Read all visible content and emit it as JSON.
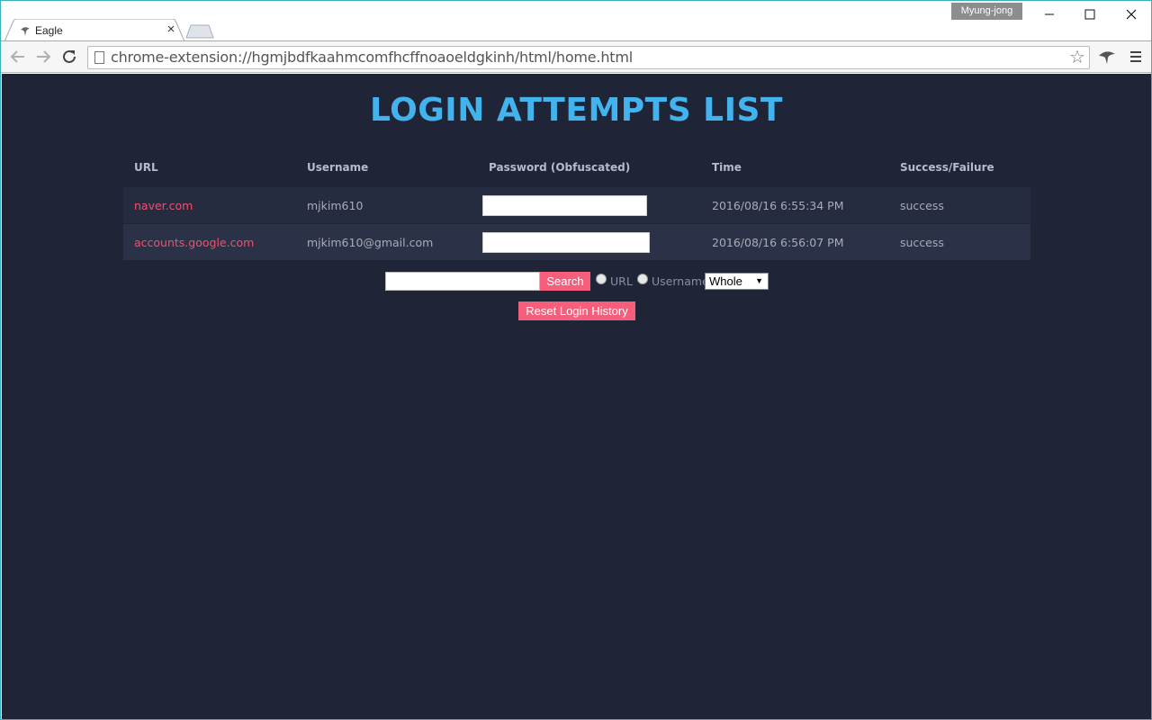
{
  "browser": {
    "tab_title": "Eagle",
    "tab_close": "×",
    "profile_name": "Myung-jong",
    "url": "chrome-extension://hgmjbdfkaahmcomfhcffnoaoeldgkinh/html/home.html",
    "back_glyph": "←",
    "forward_glyph": "→",
    "reload_glyph": "↻",
    "star_glyph": "☆",
    "menu_glyph": "≡",
    "minimize_glyph": "—",
    "maximize_glyph": "☐",
    "close_glyph": "✕"
  },
  "page": {
    "title": "LOGIN ATTEMPTS LIST",
    "columns": [
      "URL",
      "Username",
      "Password (Obfuscated)",
      "Time",
      "Success/Failure"
    ],
    "rows": [
      {
        "url": "naver.com",
        "username": "mjkim610",
        "password": "",
        "time": "2016/08/16 6:55:34 PM",
        "status": "success"
      },
      {
        "url": "accounts.google.com",
        "username": "mjkim610@gmail.com",
        "password": "",
        "time": "2016/08/16 6:56:07 PM",
        "status": "success"
      }
    ],
    "search": {
      "value": "",
      "button_label": "Search",
      "radio_url_label": "URL",
      "radio_username_label": "Username",
      "select_value": "Whole",
      "select_arrow": "▼"
    },
    "reset_label": "Reset Login History"
  },
  "colors": {
    "page_bg": "#1f2436",
    "title": "#43b3ee",
    "row_bg_1": "#262c40",
    "row_bg_2": "#2b3247",
    "link": "#f0506e",
    "accent_button": "#f55f7b"
  }
}
